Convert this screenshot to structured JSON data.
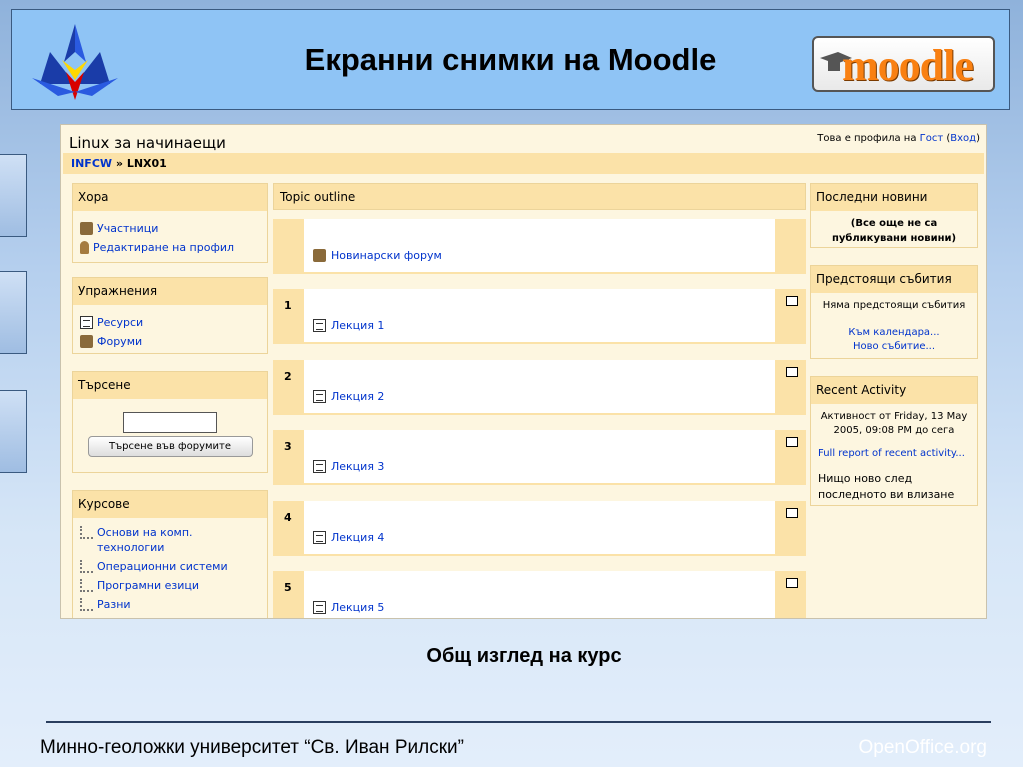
{
  "slide": {
    "title": "Екранни снимки на Moodle",
    "moodle_logo_text": "moodle",
    "caption": "Общ изглед на курс",
    "footer_left": "Минно-геоложки университет “Св. Иван Рилски”",
    "footer_right": "OpenOffice.org"
  },
  "screenshot": {
    "course_title": "Linux за начинаещи",
    "profile_prefix": "Това е профила на",
    "profile_user": "Гост",
    "profile_login": "Вход",
    "breadcrumb": {
      "root": "INFCW",
      "sep": "»",
      "current": "LNX01"
    },
    "blocks": {
      "people": {
        "title": "Хора",
        "items": [
          "Участници",
          "Редактиране на профил"
        ]
      },
      "activities": {
        "title": "Упражнения",
        "items": [
          "Ресурси",
          "Форуми"
        ]
      },
      "search": {
        "title": "Търсене",
        "input_value": "",
        "button_label": "Търсене във форумите"
      },
      "courses": {
        "title": "Курсове",
        "items": [
          "Основи на комп. технологии",
          "Операционни системи",
          "Програмни езици",
          "Разни"
        ]
      },
      "news": {
        "title": "Последни новини",
        "text": "(Все още не са публикувани новини)"
      },
      "events": {
        "title": "Предстоящи събития",
        "text": "Няма предстоящи събития",
        "link1": "Към календара...",
        "link2": "Ново събитие..."
      },
      "recent": {
        "title": "Recent Activity",
        "text": "Активност от Friday, 13 May 2005, 09:08 PM до сега",
        "link": "Full report of recent activity...",
        "footer": "Нищо ново след последното ви влизане"
      }
    },
    "topics": {
      "header": "Topic outline",
      "news_forum": "Новинарски форум",
      "sections": [
        {
          "num": "1",
          "label": "Лекция 1"
        },
        {
          "num": "2",
          "label": "Лекция 2"
        },
        {
          "num": "3",
          "label": "Лекция 3"
        },
        {
          "num": "4",
          "label": "Лекция 4"
        },
        {
          "num": "5",
          "label": "Лекция 5"
        }
      ]
    }
  },
  "colors": {
    "header_bg": "#8fc4f5",
    "block_header": "#fbe2a8",
    "link": "#0033cc",
    "moodle_orange": "#f98012"
  }
}
